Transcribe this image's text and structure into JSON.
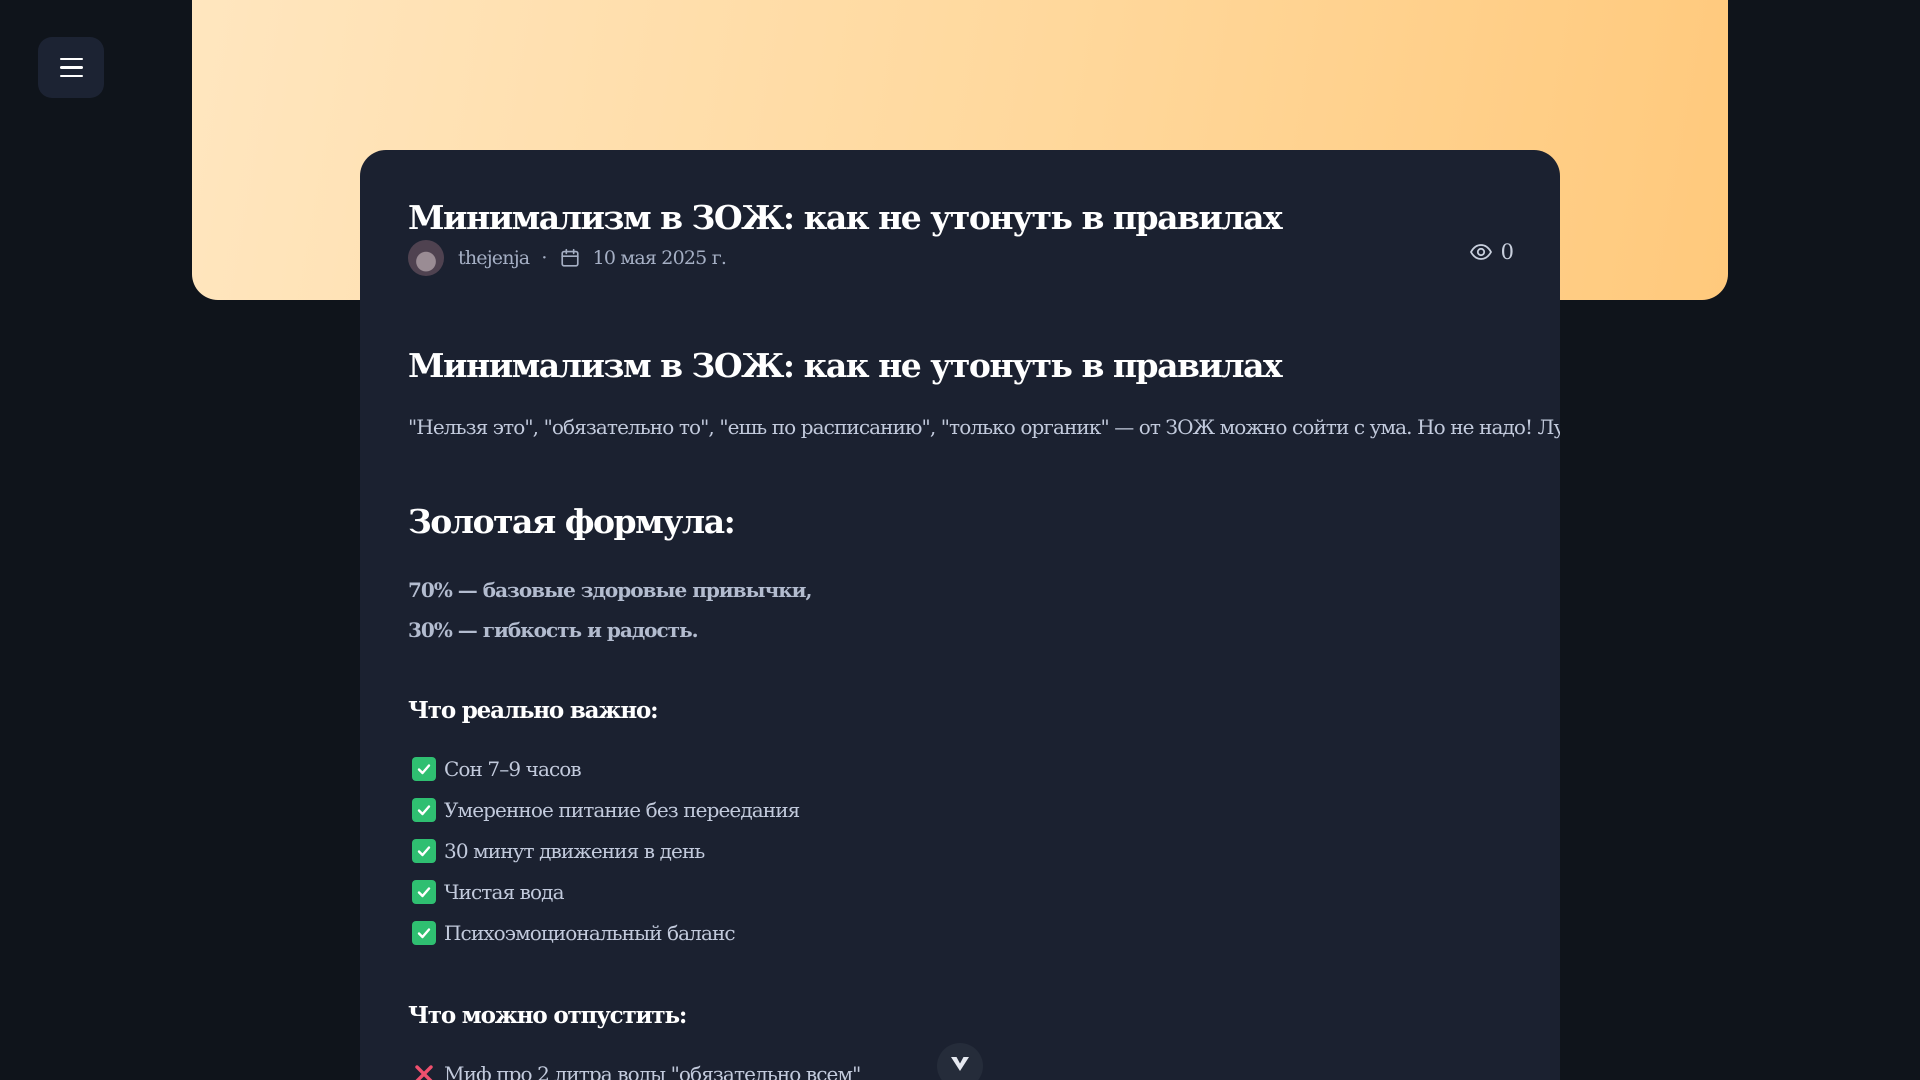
{
  "post": {
    "title": "Минимализм в ЗОЖ: как не утонуть в правилах",
    "author": "thejenja",
    "date": "10 мая 2025 г.",
    "views": "0"
  },
  "content": {
    "heading": "Минимализм в ЗОЖ: как не утонуть в правилах",
    "intro": "\"Нельзя это\", \"обязательно то\", \"ешь по расписанию\", \"только органик\" — от ЗОЖ можно сойти с ума. Но не надо! Лучше упростим.",
    "formula_heading": "Золотая формула:",
    "formula_lines": [
      "70% — базовые здоровые привычки,",
      "30% — гибкость и радость."
    ],
    "important_heading": "Что реально важно:",
    "important_items": [
      "Сон 7–9 часов",
      "Умеренное питание без переедания",
      "30 минут движения в день",
      "Чистая вода",
      "Психоэмоциональный баланс"
    ],
    "skip_heading": "Что можно отпустить:",
    "skip_items": [
      "Миф про 2 литра воды \"обязательно всем\""
    ]
  },
  "icons": {
    "menu": "hamburger-menu-icon",
    "calendar": "calendar-icon",
    "views": "eye-icon",
    "check": "check-mark-icon",
    "cross": "cross-mark-icon",
    "scroll": "chevron-down-icon"
  },
  "colors": {
    "background": "#0f141b",
    "card": "#1b2130",
    "hero_start": "#ffe6bf",
    "hero_end": "#ffc97c",
    "check": "#2fbf71",
    "cross": "#f0506e"
  }
}
